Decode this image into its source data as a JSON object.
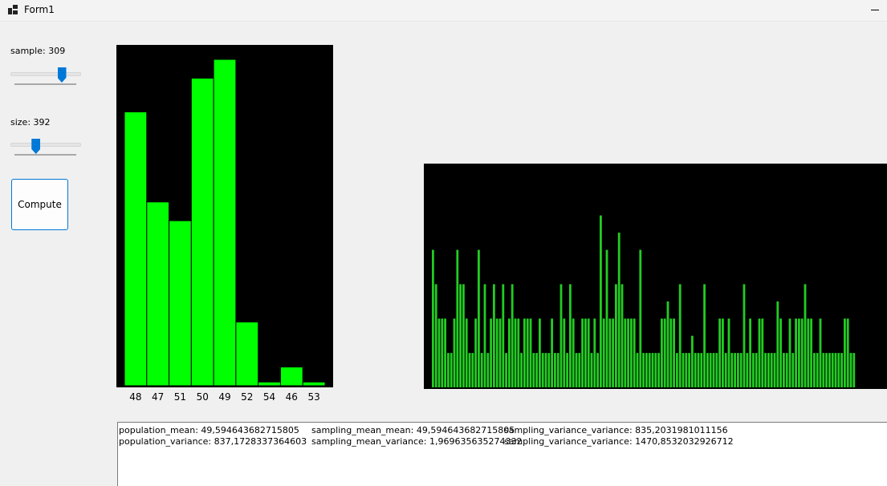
{
  "window": {
    "title": "Form1"
  },
  "controls": {
    "sample_label": "sample: 309",
    "sample_value_fraction": 0.78,
    "size_label": "size: 392",
    "size_value_fraction": 0.35,
    "compute_label": "Compute"
  },
  "chart_data": [
    {
      "type": "bar",
      "categories": [
        "48",
        "47",
        "51",
        "50",
        "49",
        "52",
        "54",
        "46",
        "53"
      ],
      "values": [
        73,
        49,
        44,
        82,
        87,
        17,
        1,
        5,
        1
      ],
      "ylim": [
        0,
        90
      ],
      "colors": {
        "bar": "#00ff00",
        "background": "#000000"
      }
    },
    {
      "type": "bar",
      "values": [
        8,
        6,
        4,
        4,
        4,
        2,
        2,
        4,
        8,
        6,
        6,
        4,
        2,
        2,
        4,
        8,
        2,
        6,
        2,
        4,
        6,
        4,
        4,
        6,
        2,
        4,
        6,
        4,
        4,
        2,
        4,
        4,
        4,
        2,
        2,
        4,
        2,
        2,
        2,
        4,
        2,
        2,
        6,
        4,
        2,
        6,
        4,
        2,
        2,
        4,
        4,
        4,
        2,
        4,
        2,
        10,
        4,
        8,
        4,
        4,
        6,
        9,
        6,
        4,
        4,
        4,
        4,
        2,
        8,
        2,
        2,
        2,
        2,
        2,
        2,
        4,
        4,
        5,
        4,
        4,
        2,
        6,
        2,
        2,
        2,
        3,
        2,
        2,
        2,
        6,
        2,
        2,
        2,
        2,
        4,
        4,
        2,
        4,
        2,
        2,
        2,
        2,
        6,
        2,
        4,
        2,
        2,
        4,
        4,
        2,
        2,
        2,
        2,
        5,
        4,
        2,
        2,
        4,
        2,
        4,
        4,
        4,
        6,
        4,
        4,
        2,
        2,
        4,
        2,
        2,
        2,
        2,
        2,
        2,
        2,
        4,
        4,
        2,
        2
      ],
      "ylim": [
        0,
        11
      ],
      "colors": {
        "bar": "#22cc22",
        "background": "#000000"
      }
    }
  ],
  "output": {
    "col1": [
      "population_mean: 49,594643682715805",
      "population_variance: 837,1728337364603"
    ],
    "col2": [
      "sampling_mean_mean: 49,594643682715805",
      "sampling_mean_variance: 1,969635635274332"
    ],
    "col3": [
      "sampling_variance_variance: 835,2031981011156",
      "sampling_variance_variance: 1470,8532032926712"
    ]
  }
}
